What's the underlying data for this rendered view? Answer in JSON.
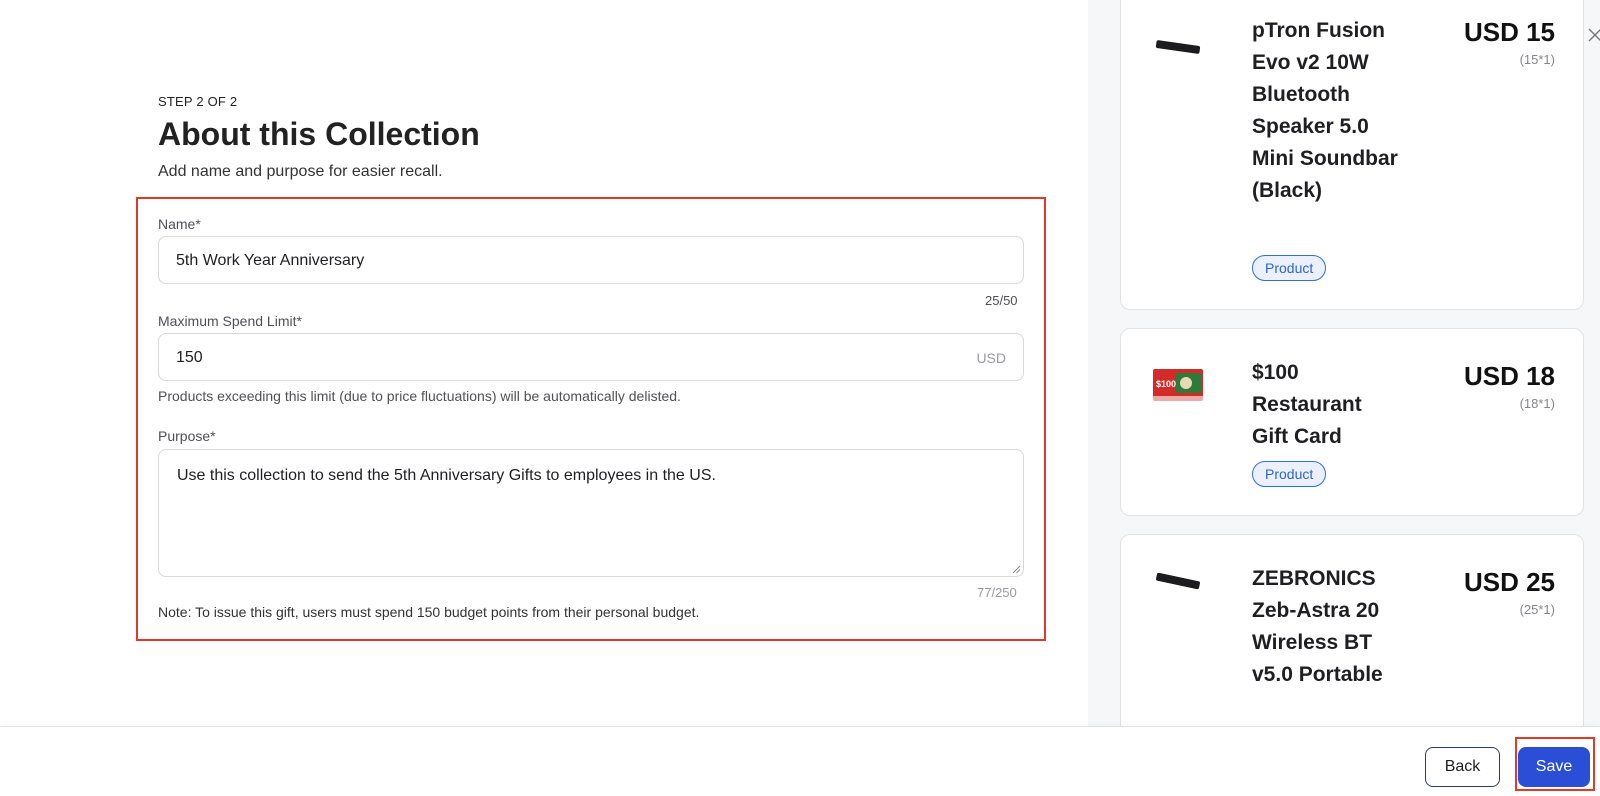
{
  "header": {
    "step": "STEP 2 OF 2",
    "title": "About this Collection",
    "subtitle": "Add name and purpose for easier recall."
  },
  "form": {
    "name": {
      "label": "Name*",
      "value": "5th Work Year Anniversary",
      "counter": "25/50"
    },
    "spend_limit": {
      "label": "Maximum Spend Limit*",
      "value": "150",
      "suffix": "USD",
      "help": "Products exceeding this limit (due to price fluctuations) will be automatically delisted."
    },
    "purpose": {
      "label": "Purpose*",
      "value": "Use this collection to send the 5th Anniversary Gifts to employees in the US.",
      "counter": "77/250"
    },
    "note": "Note: To issue this gift, users must spend 150 budget points from their personal budget."
  },
  "products": [
    {
      "name": "pTron Fusion Evo v2 10W Bluetooth Speaker 5.0 Mini Soundbar (Black)",
      "price": "USD 15",
      "calc": "(15*1)",
      "badge": "Product",
      "icon": "soundbar-image"
    },
    {
      "name": "$100 Restaurant Gift Card",
      "price": "USD 18",
      "calc": "(18*1)",
      "badge": "Product",
      "icon": "gift-card-image",
      "thumb_text": "$100"
    },
    {
      "name": "ZEBRONICS Zeb-Astra 20 Wireless BT v5.0 Portable",
      "price": "USD 25",
      "calc": "(25*1)",
      "icon": "soundbar-image"
    }
  ],
  "footer": {
    "back_label": "Back",
    "save_label": "Save"
  },
  "colors": {
    "accent": "#2a4fd6",
    "highlight": "#e03a28",
    "badge_border": "#2f6fe0"
  }
}
